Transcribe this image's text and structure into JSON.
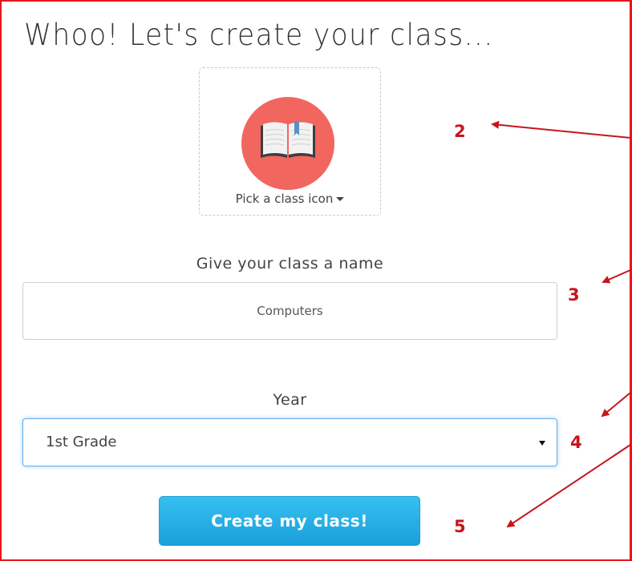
{
  "page": {
    "title": "Whoo! Let's create your class..."
  },
  "icon_picker": {
    "label": "Pick a class icon",
    "icon": "open-book-icon",
    "circle_color": "#f1665f"
  },
  "class_name": {
    "label": "Give your class a name",
    "value": "Computers"
  },
  "year": {
    "label": "Year",
    "selected": "1st Grade"
  },
  "submit": {
    "label": "Create my class!"
  },
  "annotations": {
    "color": "#c8141b",
    "markers": [
      "2",
      "3",
      "4",
      "5"
    ]
  }
}
